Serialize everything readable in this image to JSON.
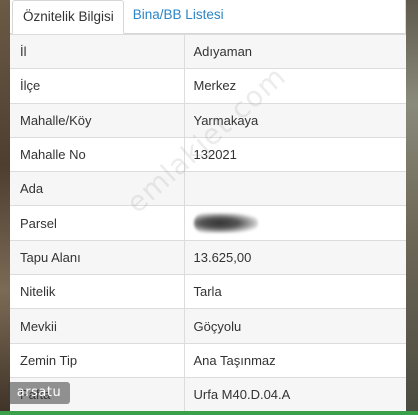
{
  "tabs": [
    {
      "label": "Öznitelik Bilgisi",
      "active": true
    },
    {
      "label": "Bina/BB Listesi",
      "active": false
    }
  ],
  "attributes": [
    {
      "key": "İl",
      "value": "Adıyaman"
    },
    {
      "key": "İlçe",
      "value": "Merkez"
    },
    {
      "key": "Mahalle/Köy",
      "value": "Yarmakaya"
    },
    {
      "key": "Mahalle No",
      "value": "132021"
    },
    {
      "key": "Ada",
      "value": ""
    },
    {
      "key": "Parsel",
      "value": ""
    },
    {
      "key": "Tapu Alanı",
      "value": "13.625,00"
    },
    {
      "key": "Nitelik",
      "value": "Tarla"
    },
    {
      "key": "Mevkii",
      "value": "Göçyolu"
    },
    {
      "key": "Zemin Tip",
      "value": "Ana Taşınmaz"
    },
    {
      "key": "Pafta",
      "value": "Urfa M40.D.04.A"
    }
  ],
  "watermark": "emlakjet.com",
  "logo_badge": "arsatu",
  "colors": {
    "tab_link": "#2b86c4",
    "bottom_bar": "#3aa04a"
  }
}
